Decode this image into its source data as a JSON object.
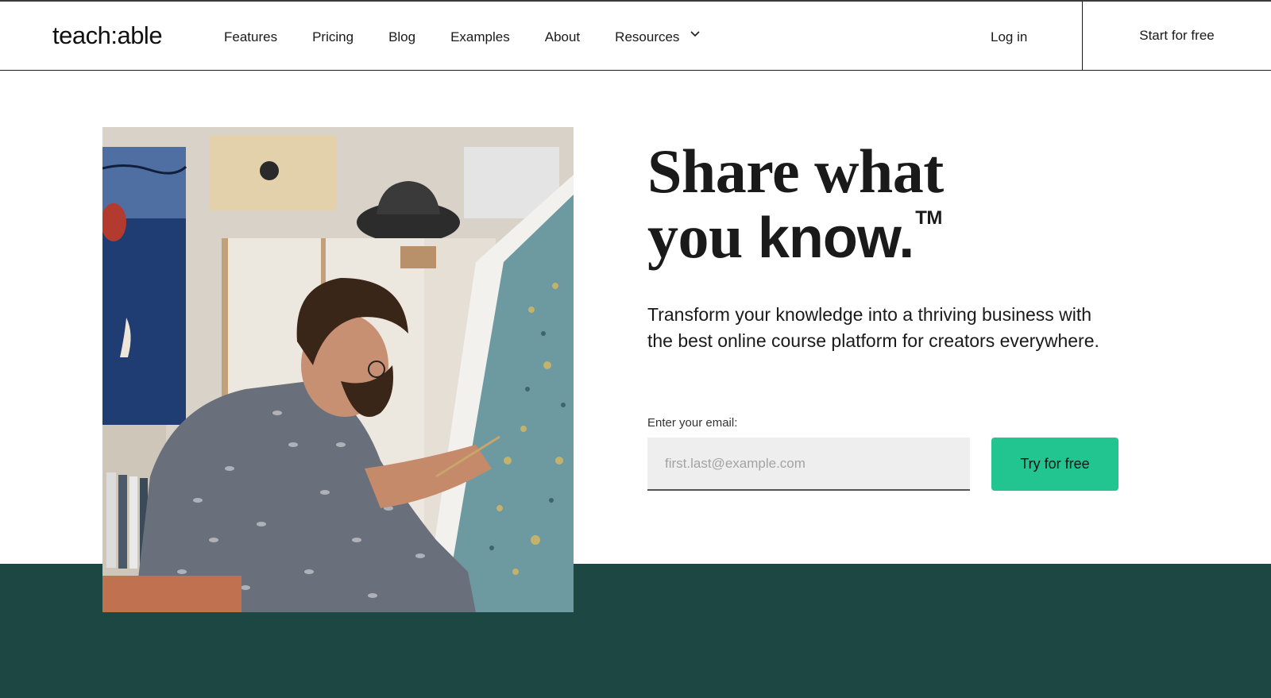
{
  "header": {
    "logo": "teach:able",
    "nav": [
      {
        "label": "Features"
      },
      {
        "label": "Pricing"
      },
      {
        "label": "Blog"
      },
      {
        "label": "Examples"
      },
      {
        "label": "About"
      },
      {
        "label": "Resources",
        "has_dropdown": true
      }
    ],
    "login_label": "Log in",
    "start_free_label": "Start for free"
  },
  "hero": {
    "headline_line1": "Share what",
    "headline_line2_serif": "you ",
    "headline_line2_sans": "know.",
    "headline_tm": "TM",
    "subtitle": "Transform your knowledge into a thriving business with the best online course platform for creators everywhere.",
    "email_label": "Enter your email:",
    "email_placeholder": "first.last@example.com",
    "email_value": "",
    "cta_label": "Try for free"
  },
  "colors": {
    "accent_button": "#22c490",
    "band": "#1c4743"
  }
}
